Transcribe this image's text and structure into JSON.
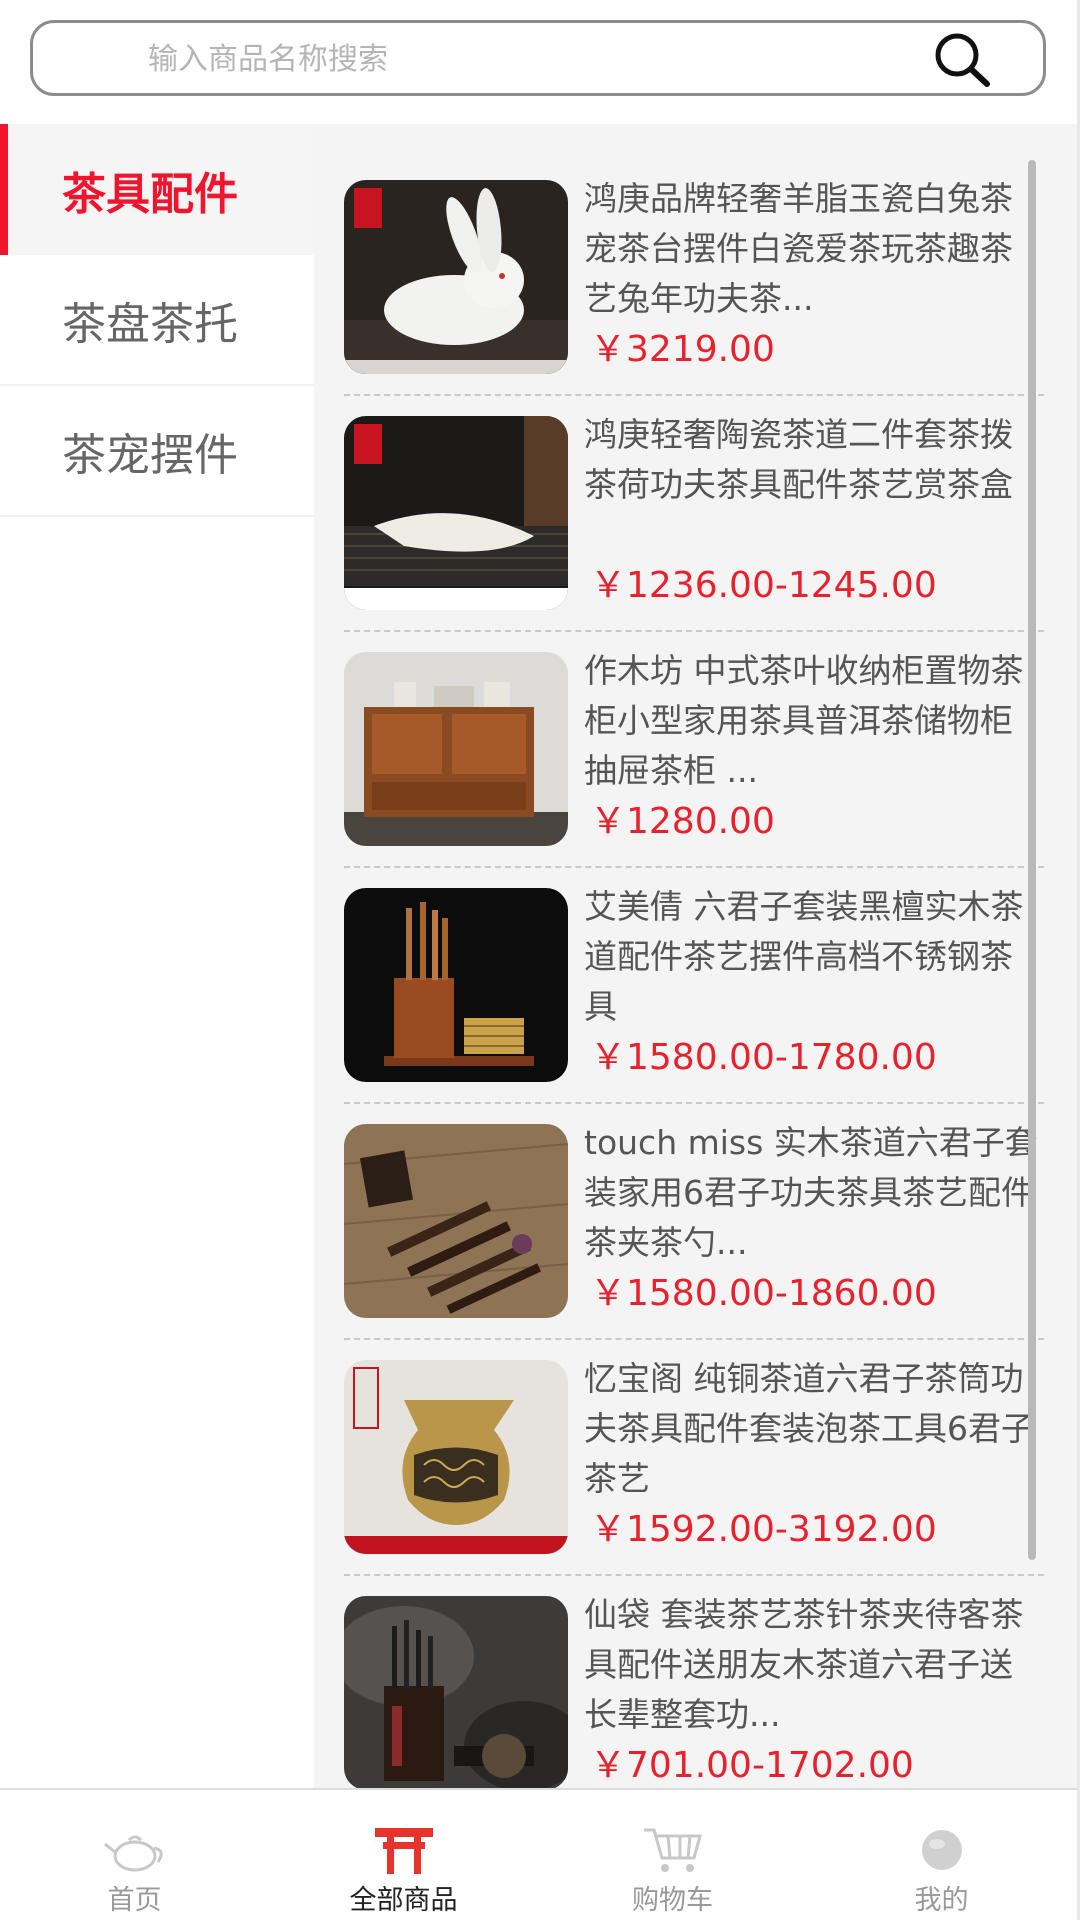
{
  "search": {
    "placeholder": "输入商品名称搜索"
  },
  "sidebar": {
    "items": [
      {
        "label": "茶具配件",
        "active": true
      },
      {
        "label": "茶盘茶托",
        "active": false
      },
      {
        "label": "茶宠摆件",
        "active": false
      }
    ]
  },
  "products": [
    {
      "title": "鸿庚品牌轻奢羊脂玉瓷白兔茶宠茶台摆件白瓷爱茶玩茶趣茶艺兔年功夫茶...",
      "price": "￥3219.00",
      "image": "white-rabbit-figurine"
    },
    {
      "title": "鸿庚轻奢陶瓷茶道二件套茶拨茶荷功夫茶具配件茶艺赏茶盒",
      "price": "￥1236.00-1245.00",
      "image": "ceramic-tea-scoop"
    },
    {
      "title": "作木坊 中式茶叶收纳柜置物茶柜小型家用茶具普洱茶储物柜抽屉茶柜 ...",
      "price": "￥1280.00",
      "image": "wooden-tea-cabinet"
    },
    {
      "title": "艾美倩 六君子套装黑檀实木茶道配件茶艺摆件高档不锈钢茶具",
      "price": "￥1580.00-1780.00",
      "image": "tea-tool-set"
    },
    {
      "title": "touch miss 实木茶道六君子套装家用6君子功夫茶具茶艺配件茶夹茶勺...",
      "price": "￥1580.00-1860.00",
      "image": "wooden-tea-tools"
    },
    {
      "title": "忆宝阁 纯铜茶道六君子茶筒功夫茶具配件套装泡茶工具6君子茶艺",
      "price": "￥1592.00-3192.00",
      "image": "copper-tea-vase"
    },
    {
      "title": "仙袋 套装茶艺茶针茶夹待客茶具配件送朋友木茶道六君子送长辈整套功...",
      "price": "￥701.00-1702.00",
      "image": "dark-tea-tool-set"
    }
  ],
  "tabbar": {
    "items": [
      {
        "label": "首页",
        "icon": "teapot-icon",
        "active": false
      },
      {
        "label": "全部商品",
        "icon": "torii-gate-icon",
        "active": true
      },
      {
        "label": "购物车",
        "icon": "cart-icon",
        "active": false
      },
      {
        "label": "我的",
        "icon": "profile-icon",
        "active": false
      }
    ]
  },
  "colors": {
    "accent": "#f0142d",
    "price": "#e8212c"
  }
}
